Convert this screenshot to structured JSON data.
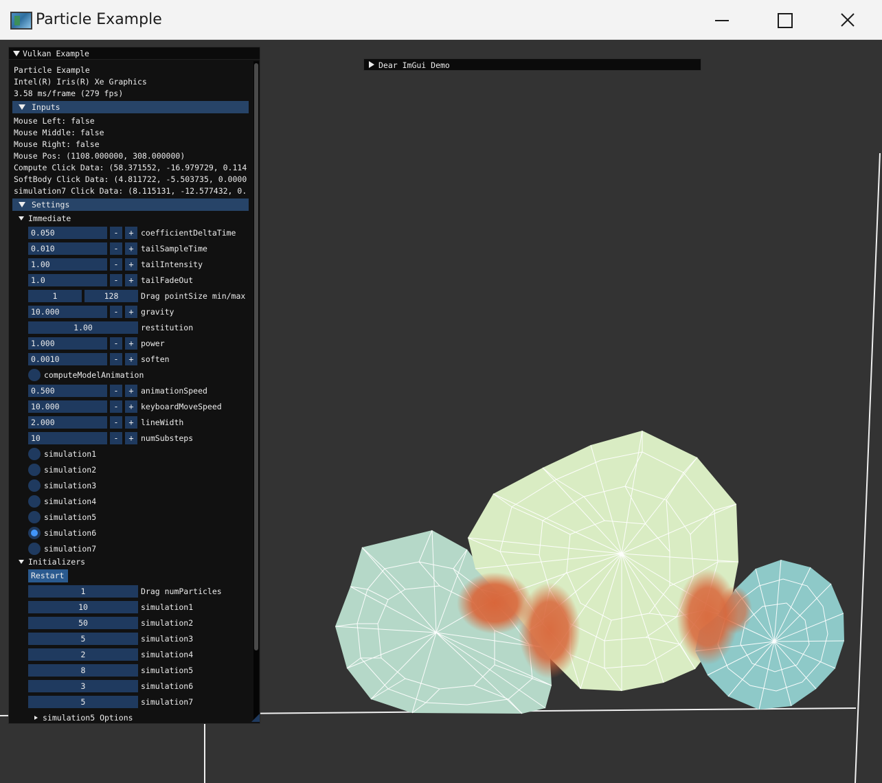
{
  "window": {
    "title": "Particle Example"
  },
  "demo_window": {
    "title": "Dear ImGui Demo"
  },
  "panel": {
    "title": "Vulkan Example",
    "info": [
      "Particle Example",
      "Intel(R) Iris(R) Xe Graphics",
      "3.58 ms/frame (279 fps)"
    ],
    "inputs": {
      "label": "Inputs",
      "lines": [
        "Mouse Left: false",
        "Mouse Middle: false",
        "Mouse Right: false",
        "Mouse Pos: (1108.000000, 308.000000)",
        "Compute Click Data: (58.371552, -16.979729, 0.114",
        "SoftBody Click Data: (4.811722, -5.503735, 0.0000",
        "simulation7 Click Data: (8.115131, -12.577432, 0."
      ]
    },
    "settings": {
      "label": "Settings",
      "immediate": {
        "label": "Immediate",
        "steppers": [
          {
            "value": "0.050",
            "label": "coefficientDeltaTime"
          },
          {
            "value": "0.010",
            "label": "tailSampleTime"
          },
          {
            "value": "1.00",
            "label": "tailIntensity"
          },
          {
            "value": "1.0",
            "label": "tailFadeOut"
          }
        ],
        "point_size": {
          "min": "1",
          "max": "128",
          "label": "Drag pointSize min/max"
        },
        "gravity": {
          "value": "10.000",
          "label": "gravity"
        },
        "restitution": {
          "value": "1.00",
          "label": "restitution"
        },
        "power": {
          "value": "1.000",
          "label": "power"
        },
        "soften": {
          "value": "0.0010",
          "label": "soften"
        },
        "compute_model_animation": "computeModelAnimation",
        "more_steppers": [
          {
            "value": "0.500",
            "label": "animationSpeed"
          },
          {
            "value": "10.000",
            "label": "keyboardMoveSpeed"
          },
          {
            "value": "2.000",
            "label": "lineWidth"
          },
          {
            "value": "10",
            "label": "numSubsteps"
          }
        ],
        "radios": [
          "simulation1",
          "simulation2",
          "simulation3",
          "simulation4",
          "simulation5",
          "simulation6",
          "simulation7"
        ],
        "selected_radio": "simulation6"
      },
      "initializers": {
        "label": "Initializers",
        "restart": "Restart",
        "drags": [
          {
            "value": "1",
            "label": "Drag numParticles"
          },
          {
            "value": "10",
            "label": "simulation1"
          },
          {
            "value": "50",
            "label": "simulation2"
          },
          {
            "value": "5",
            "label": "simulation3"
          },
          {
            "value": "2",
            "label": "simulation4"
          },
          {
            "value": "8",
            "label": "simulation5"
          },
          {
            "value": "3",
            "label": "simulation6"
          },
          {
            "value": "5",
            "label": "simulation7"
          }
        ],
        "sub_tree": "simulation5 Options"
      }
    },
    "stepper_minus": "-",
    "stepper_plus": "+"
  },
  "colors": {
    "imgui_frame": "#1f3a5f",
    "imgui_header": "#274468",
    "radio_active": "#4296fa",
    "body_left": "#b5d8c8",
    "body_middle": "#d9ecc3",
    "body_right": "#8ec9c8",
    "contact_heat": "#d9663a"
  }
}
